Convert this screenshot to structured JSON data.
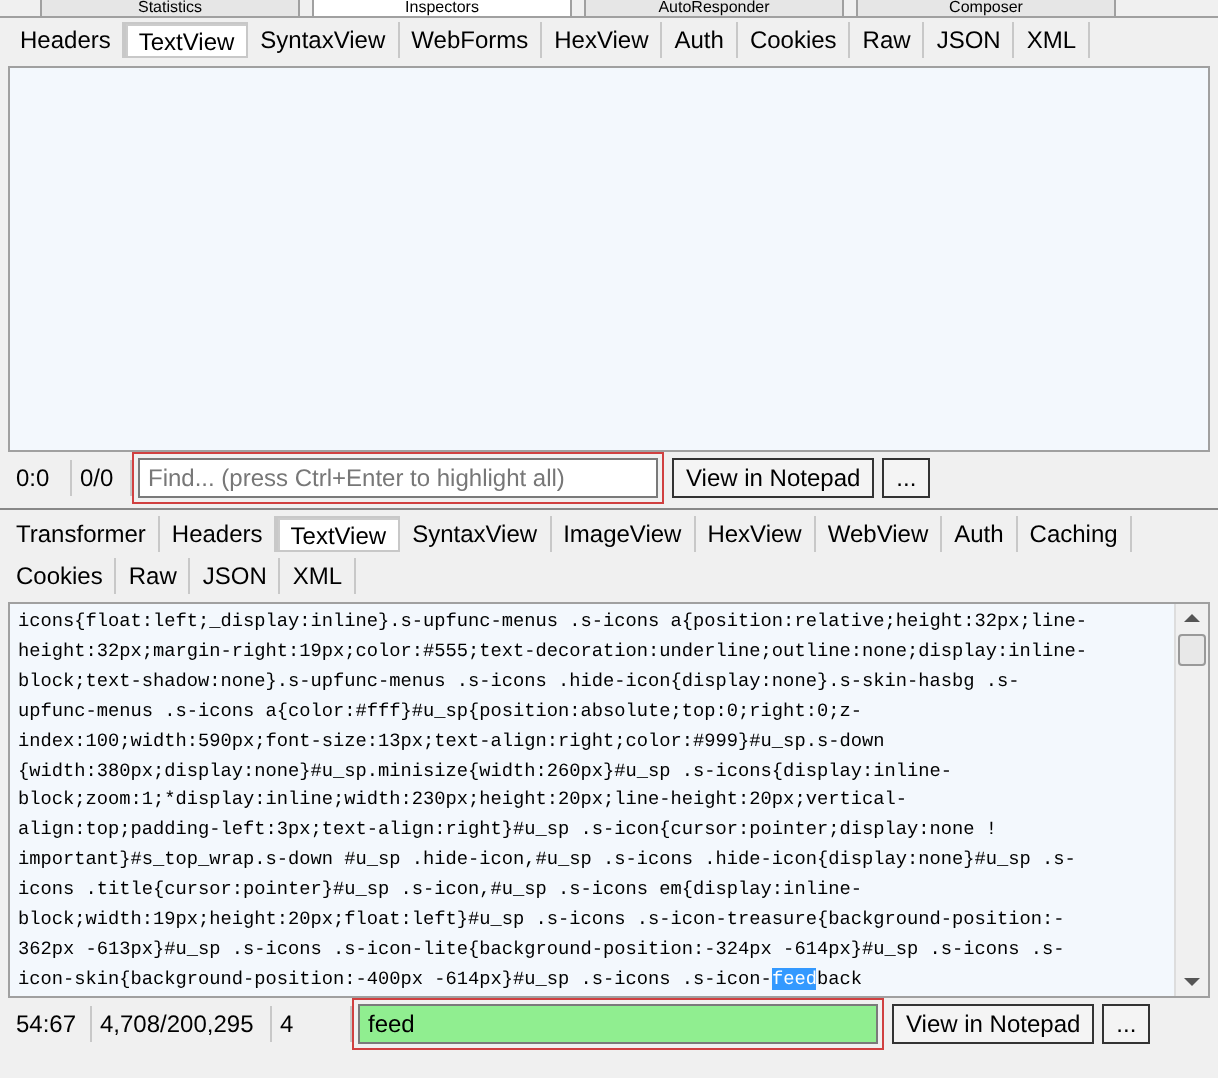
{
  "top_tabs": [
    {
      "label": "Statistics",
      "selected": false
    },
    {
      "label": "Inspectors",
      "selected": true
    },
    {
      "label": "AutoResponder",
      "selected": false
    },
    {
      "label": "Composer",
      "selected": false
    }
  ],
  "request_tabs": [
    {
      "label": "Headers",
      "selected": false
    },
    {
      "label": "TextView",
      "selected": true
    },
    {
      "label": "SyntaxView",
      "selected": false
    },
    {
      "label": "WebForms",
      "selected": false
    },
    {
      "label": "HexView",
      "selected": false
    },
    {
      "label": "Auth",
      "selected": false
    },
    {
      "label": "Cookies",
      "selected": false
    },
    {
      "label": "Raw",
      "selected": false
    },
    {
      "label": "JSON",
      "selected": false
    },
    {
      "label": "XML",
      "selected": false
    }
  ],
  "request_status": {
    "position": "0:0",
    "count": "0/0",
    "find": {
      "placeholder": "Find... (press Ctrl+Enter to highlight all)",
      "matched": false
    },
    "buttons": [
      "View in Notepad",
      "..."
    ]
  },
  "response_tabs": [
    [
      {
        "label": "Transformer",
        "selected": false
      },
      {
        "label": "Headers",
        "selected": false
      },
      {
        "label": "TextView",
        "selected": true
      },
      {
        "label": "SyntaxView",
        "selected": false
      },
      {
        "label": "ImageView",
        "selected": false
      },
      {
        "label": "HexView",
        "selected": false
      },
      {
        "label": "WebView",
        "selected": false
      },
      {
        "label": "Auth",
        "selected": false
      },
      {
        "label": "Caching",
        "selected": false
      }
    ],
    [
      {
        "label": "Cookies",
        "selected": false
      },
      {
        "label": "Raw",
        "selected": false
      },
      {
        "label": "JSON",
        "selected": false
      },
      {
        "label": "XML",
        "selected": false
      }
    ]
  ],
  "response_lines": [
    [
      {
        "text": "icons{float:left;_display:inline}.s-upfunc-menus .s-icons a{position:relative;height:32px;line-",
        "highlighted": false
      }
    ],
    [
      {
        "text": "height:32px;margin-right:19px;color:#555;text-decoration:underline;outline:none;display:inline-",
        "highlighted": false
      }
    ],
    [
      {
        "text": "block;text-shadow:none}.s-upfunc-menus .s-icons .hide-icon{display:none}.s-skin-hasbg .s-",
        "highlighted": false
      }
    ],
    [
      {
        "text": "upfunc-menus .s-icons a{color:#fff}#u_sp{position:absolute;top:0;right:0;z-",
        "highlighted": false
      }
    ],
    [
      {
        "text": "index:100;width:590px;font-size:13px;text-align:right;color:#999}#u_sp.s-down",
        "highlighted": false
      }
    ],
    [
      {
        "text": "{width:380px;display:none}#u_sp.minisize{width:260px}#u_sp .s-icons{display:inline-",
        "highlighted": false
      }
    ],
    [
      {
        "text": "block;zoom:1;*display:inline;width:230px;height:20px;line-height:20px;vertical-",
        "highlighted": false
      }
    ],
    [
      {
        "text": "align:top;padding-left:3px;text-align:right}#u_sp .s-icon{cursor:pointer;display:none !",
        "highlighted": false
      }
    ],
    [
      {
        "text": "important}#s_top_wrap.s-down #u_sp .hide-icon,#u_sp .s-icons .hide-icon{display:none}#u_sp .s-",
        "highlighted": false
      }
    ],
    [
      {
        "text": "icons .title{cursor:pointer}#u_sp .s-icon,#u_sp .s-icons em{display:inline-",
        "highlighted": false
      }
    ],
    [
      {
        "text": "block;width:19px;height:20px;float:left}#u_sp .s-icons .s-icon-treasure{background-position:-",
        "highlighted": false
      }
    ],
    [
      {
        "text": "362px -613px}#u_sp .s-icons .s-icon-lite{background-position:-324px -614px}#u_sp .s-icons .s-",
        "highlighted": false
      }
    ],
    [
      {
        "text": "icon-skin{background-position:-400px -614px}#u_sp .s-icons .s-icon-",
        "highlighted": false
      },
      {
        "text": "feed",
        "highlighted": true
      },
      {
        "text": "back",
        "highlighted": false
      }
    ]
  ],
  "response_status": {
    "position": "54:67",
    "count": "4,708/200,295",
    "matches": "4",
    "find": {
      "value": "feed",
      "matched": true
    },
    "buttons": [
      "View in Notepad",
      "..."
    ]
  }
}
